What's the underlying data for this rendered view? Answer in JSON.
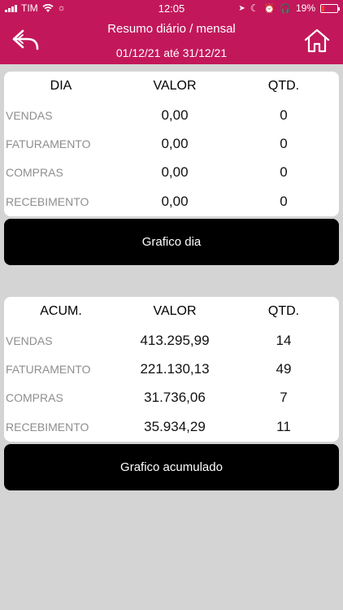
{
  "status_bar": {
    "carrier": "TIM",
    "time": "12:05",
    "battery": "19%",
    "battery_level": 0.19
  },
  "header": {
    "title": "Resumo diário / mensal",
    "period": "01/12/21 até 31/12/21",
    "back_icon": "back-arrow-icon",
    "home_icon": "home-icon"
  },
  "daily": {
    "headers": {
      "label": "DIA",
      "value": "VALOR",
      "qty": "QTD."
    },
    "rows": [
      {
        "label": "VENDAS",
        "value": "0,00",
        "qty": "0"
      },
      {
        "label": "FATURAMENTO",
        "value": "0,00",
        "qty": "0"
      },
      {
        "label": "COMPRAS",
        "value": "0,00",
        "qty": "0"
      },
      {
        "label": "RECEBIMENTO",
        "value": "0,00",
        "qty": "0"
      }
    ],
    "button_label": "Grafico dia"
  },
  "accumulated": {
    "headers": {
      "label": "ACUM.",
      "value": "VALOR",
      "qty": "QTD."
    },
    "rows": [
      {
        "label": "VENDAS",
        "value": "413.295,99",
        "qty": "14"
      },
      {
        "label": "FATURAMENTO",
        "value": "221.130,13",
        "qty": "49"
      },
      {
        "label": "COMPRAS",
        "value": "31.736,06",
        "qty": "7"
      },
      {
        "label": "RECEBIMENTO",
        "value": "35.934,29",
        "qty": "11"
      }
    ],
    "button_label": "Grafico acumulado"
  },
  "colors": {
    "brand": "#c2185b",
    "background": "#d4d4d4",
    "button": "#000000"
  }
}
